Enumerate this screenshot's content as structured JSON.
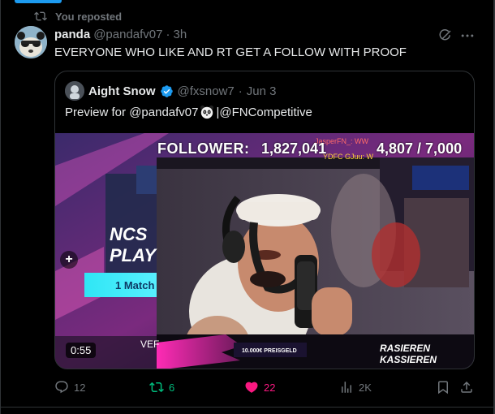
{
  "repost": {
    "label": "You reposted"
  },
  "post": {
    "author_name": "panda",
    "author_handle": "@pandafv07",
    "separator": "·",
    "time": "3h",
    "text": "EVERYONE WHO LIKE AND RT GET A FOLLOW WITH PROOF"
  },
  "quote": {
    "author_name": "Aight Snow",
    "author_handle": "@fxsnow7",
    "separator": "·",
    "time": "Jun 3",
    "text_before": "Preview for @pandafv07",
    "text_after": "|@FNCompetitive",
    "media": {
      "follower_label": "FOLLOWER:",
      "follower_count": "1,827,041",
      "follower_goal": "4,807 / 7,000",
      "chat_line1": "JasperFN_: WW",
      "chat_line2": "YDFC GJuu: W",
      "fncs_line1": "NCS",
      "fncs_line2": "PLAY",
      "match_label": "1 Match",
      "ver_label": "VEF",
      "prize_label": "10.000€ PREISGELD",
      "brand_label": "RASIEREN KASSIEREN",
      "duration": "0:55",
      "plus": "+"
    }
  },
  "actions": {
    "replies": "12",
    "reposts": "6",
    "likes": "22",
    "views": "2K"
  },
  "colors": {
    "accent": "#1d9bf0",
    "repost_active": "#00ba7c",
    "like_active": "#f91880",
    "muted": "#71767b"
  }
}
